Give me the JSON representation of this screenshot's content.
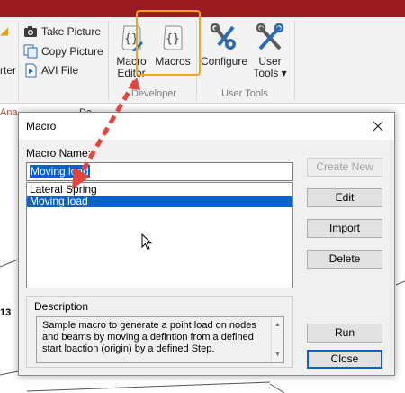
{
  "ribbon": {
    "small_buttons": [
      {
        "label": "Take Picture",
        "icon": "camera-icon"
      },
      {
        "label": "Copy Picture",
        "icon": "copy-picture-icon"
      },
      {
        "label": "AVI File",
        "icon": "avi-file-icon"
      }
    ],
    "clipped_left_text": "rter",
    "large_buttons": {
      "macro_editor": "Macro Editor",
      "macros": "Macros",
      "configure": "Configure",
      "user_tools": "User Tools ▾"
    },
    "groups": {
      "developer": "Developer",
      "user_tools": "User Tools"
    }
  },
  "background": {
    "tab_text": "Ana",
    "tab_text_2": "Da",
    "node_label": "13"
  },
  "dialog": {
    "title": "Macro",
    "macro_name_label": "Macro Name:",
    "macro_name_value": "Moving load",
    "macros": [
      {
        "name": "Lateral Spring",
        "selected": false
      },
      {
        "name": "Moving load",
        "selected": true
      }
    ],
    "description_label": "Description",
    "description_text": "Sample macro to generate a point load on nodes and beams by moving a defintion from a defined start loaction (origin) by a defined Step.",
    "buttons": {
      "create_new": "Create New",
      "edit": "Edit",
      "import": "Import",
      "delete": "Delete",
      "run": "Run",
      "close": "Close"
    }
  },
  "colors": {
    "accent_red": "#9b1c1f",
    "highlight_orange": "#f0a51e",
    "selection_blue": "#0a62c9",
    "arrow_red": "#e2463c"
  }
}
